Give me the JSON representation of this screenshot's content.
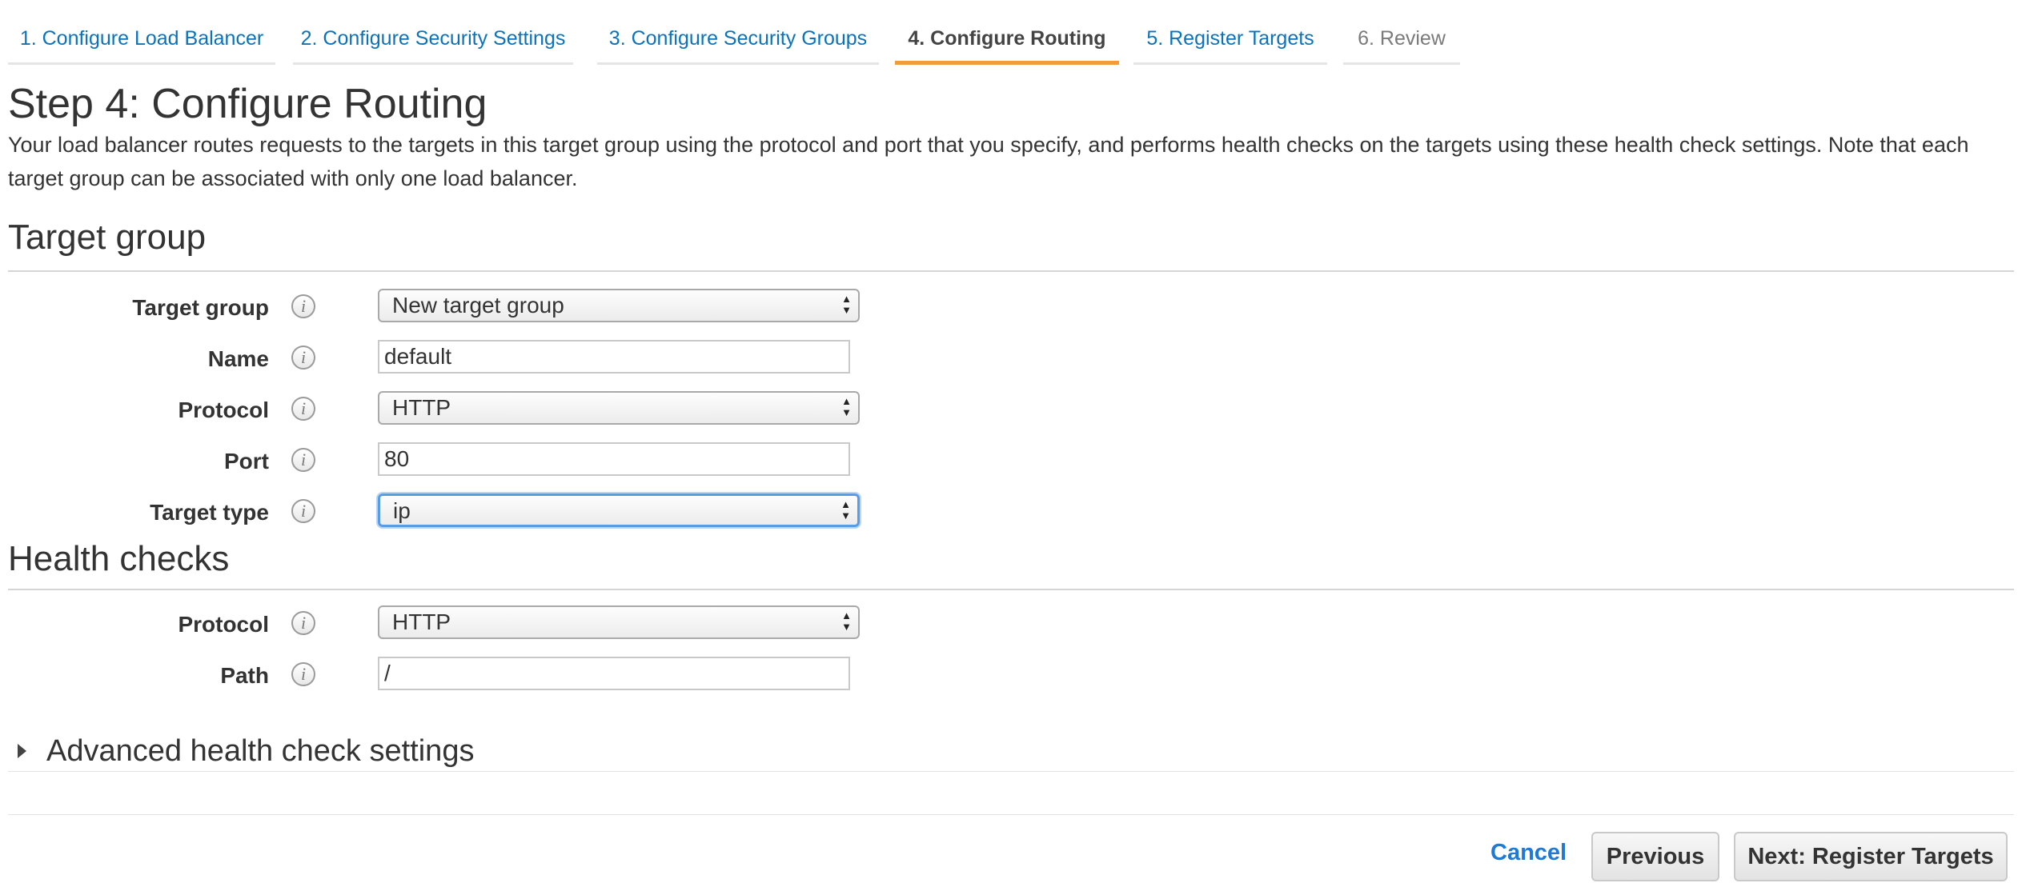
{
  "wizard": {
    "tabs": [
      {
        "label": "1. Configure Load Balancer"
      },
      {
        "label": "2. Configure Security Settings"
      },
      {
        "label": "3. Configure Security Groups"
      },
      {
        "label": "4. Configure Routing"
      },
      {
        "label": "5. Register Targets"
      },
      {
        "label": "6. Review"
      }
    ],
    "active_index": 3
  },
  "page": {
    "title": "Step 4: Configure Routing",
    "description": "Your load balancer routes requests to the targets in this target group using the protocol and port that you specify, and performs health checks on the targets using these health check settings. Note that each target group can be associated with only one load balancer."
  },
  "target_group": {
    "heading": "Target group",
    "fields": {
      "target_group": {
        "label": "Target group",
        "value": "New target group"
      },
      "name": {
        "label": "Name",
        "value": "default"
      },
      "protocol": {
        "label": "Protocol",
        "value": "HTTP"
      },
      "port": {
        "label": "Port",
        "value": "80"
      },
      "target_type": {
        "label": "Target type",
        "value": "ip"
      }
    }
  },
  "health_checks": {
    "heading": "Health checks",
    "fields": {
      "protocol": {
        "label": "Protocol",
        "value": "HTTP"
      },
      "path": {
        "label": "Path",
        "value": "/"
      }
    },
    "advanced_label": "Advanced health check settings"
  },
  "icons": {
    "info": "i",
    "select_arrows": "▲▼"
  },
  "footer": {
    "cancel": "Cancel",
    "previous": "Previous",
    "next": "Next: Register Targets"
  },
  "colors": {
    "link": "#0a73bb",
    "active_tab_underline": "#f39b3a",
    "focus_ring": "#5a9be5",
    "cancel_link": "#1f7ad6"
  }
}
